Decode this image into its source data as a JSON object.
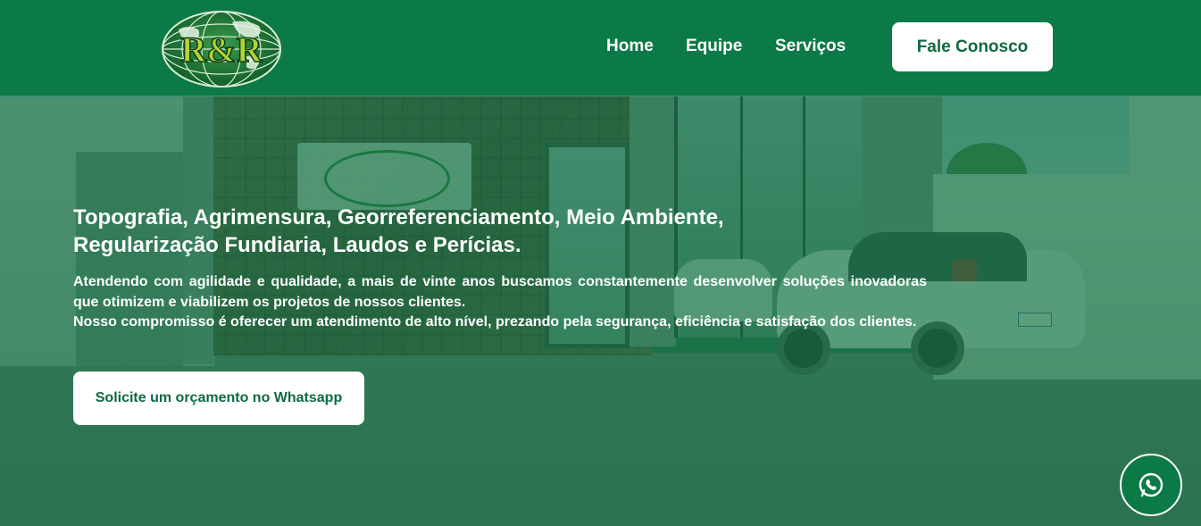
{
  "brand": {
    "logo_text": "R&R"
  },
  "nav": {
    "items": [
      {
        "label": "Home"
      },
      {
        "label": "Equipe"
      },
      {
        "label": "Serviços"
      }
    ],
    "cta_label": "Fale Conosco"
  },
  "hero": {
    "title_line1": "Topografia, Agrimensura, Georreferenciamento, Meio Ambiente,",
    "title_line2": "Regularização Fundiaria, Laudos e Perícias.",
    "paragraph1": "Atendendo com agilidade e qualidade, a mais de vinte anos buscamos constantemente desenvolver soluções inovadoras que otimizem e viabilizem os projetos de nossos clientes.",
    "paragraph2": "Nosso compromisso é oferecer um atendimento de alto nível, prezando pela segurança, eficiência e satisfação dos clientes.",
    "cta_label": "Solicite um orçamento no Whatsapp"
  },
  "floating": {
    "icon": "whatsapp-icon"
  },
  "colors": {
    "header_green": "#0c7a47",
    "overlay_green": "#127646",
    "button_text_green": "#0f6a41",
    "white": "#ffffff"
  }
}
